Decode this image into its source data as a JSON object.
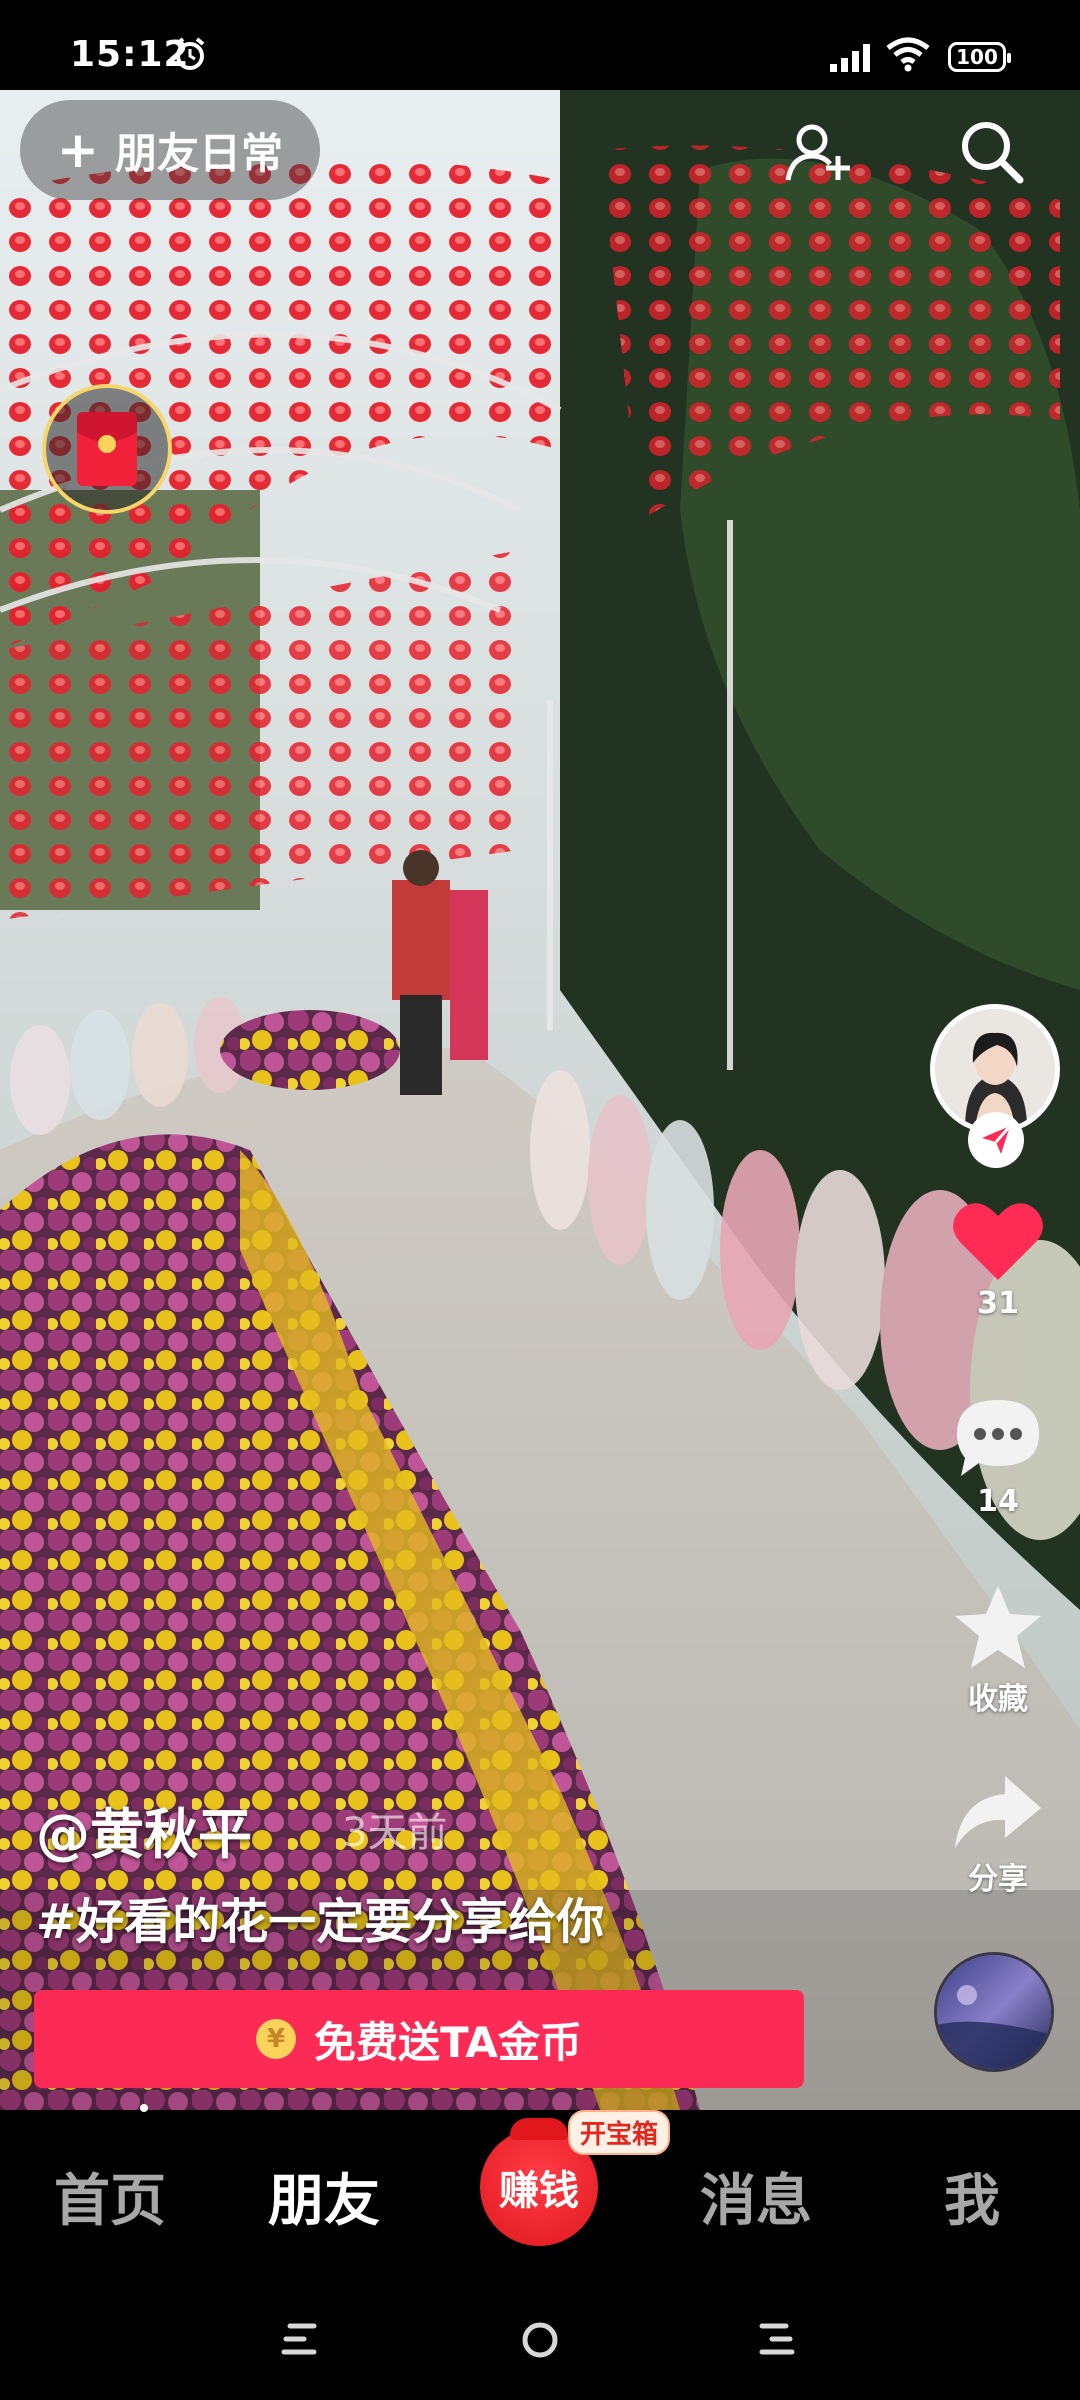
{
  "status_bar": {
    "time": "15:12",
    "battery": "100"
  },
  "top_bar": {
    "friend_daily_label": "朋友日常"
  },
  "video": {
    "author": "@黄秋平",
    "time_ago": "3天前",
    "hashtag": "#好看的花一定要分享给你"
  },
  "actions": {
    "likes": "31",
    "comments": "14",
    "favorite_label": "收藏",
    "share_label": "分享"
  },
  "coin_button": {
    "label": "免费送TA金币",
    "icon_glyph": "¥"
  },
  "bottom_nav": {
    "items": [
      "首页",
      "朋友",
      "赚钱",
      "消息",
      "我"
    ],
    "active": "朋友",
    "treasure_badge": "开宝箱"
  },
  "colors": {
    "accent": "#fc2b55",
    "like": "#fe2c55",
    "earn": "#e0181e"
  }
}
